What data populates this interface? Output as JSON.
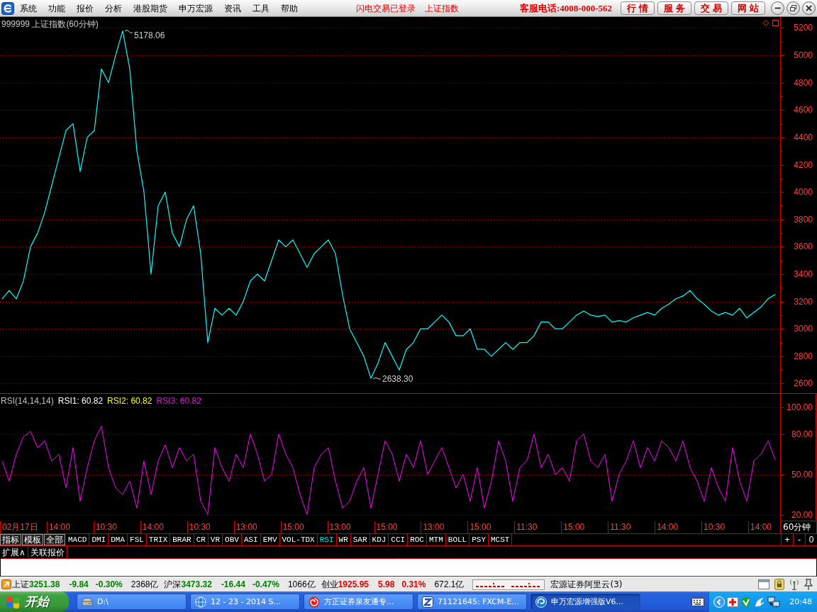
{
  "menu_bar": {
    "menus": [
      "系统",
      "功能",
      "报价",
      "分析",
      "港股期货",
      "申万宏源",
      "资讯",
      "工具",
      "帮助"
    ],
    "notices": [
      "闪电交易已登录",
      "上证指数"
    ],
    "hotline": "客服电话:4008-000-562",
    "buttons": [
      "行 情",
      "服 务",
      "交 易",
      "网 站"
    ]
  },
  "price_chart": {
    "chart_data": {
      "type": "line",
      "title": "999999 上证指数(60分钟)",
      "ylim": [
        2530,
        5280
      ],
      "yticks": [
        2600,
        2800,
        3000,
        3200,
        3400,
        3600,
        3800,
        4000,
        4200,
        4400,
        4600,
        4800,
        5000,
        5200
      ],
      "grid": true,
      "series": [
        {
          "color": "#00ffff",
          "values": [
            3220,
            3280,
            3220,
            3350,
            3600,
            3700,
            3850,
            4050,
            4250,
            4450,
            4500,
            4150,
            4400,
            4450,
            4900,
            4800,
            5000,
            5178,
            4900,
            4300,
            4000,
            3400,
            3900,
            4000,
            3700,
            3600,
            3800,
            3900,
            3550,
            2900,
            3150,
            3100,
            3150,
            3100,
            3200,
            3350,
            3400,
            3350,
            3500,
            3650,
            3600,
            3650,
            3550,
            3450,
            3550,
            3600,
            3650,
            3550,
            3250,
            3000,
            2900,
            2800,
            2638,
            2750,
            2900,
            2800,
            2700,
            2850,
            2900,
            3000,
            3000,
            3050,
            3100,
            3050,
            2950,
            2950,
            3000,
            2850,
            2850,
            2800,
            2850,
            2900,
            2850,
            2900,
            2900,
            2950,
            3050,
            3050,
            3000,
            3000,
            3050,
            3100,
            3130,
            3100,
            3090,
            3100,
            3050,
            3060,
            3050,
            3080,
            3100,
            3120,
            3100,
            3150,
            3180,
            3220,
            3240,
            3280,
            3220,
            3180,
            3130,
            3100,
            3120,
            3100,
            3150,
            3080,
            3120,
            3160,
            3220,
            3251
          ]
        }
      ],
      "annotations": [
        "5178.06",
        "2638.30"
      ]
    }
  },
  "rsi_chart": {
    "legend": [
      {
        "label": "RSI(14,14,14)",
        "color": "#c0c0c0"
      },
      {
        "label": "RSI1: 60.82",
        "color": "#ffffff"
      },
      {
        "label": "RSI2: 60.82",
        "color": "#ffff00"
      },
      {
        "label": "RSI3: 60.82",
        "color": "#ff00ff"
      }
    ],
    "chart_data": {
      "type": "line",
      "ylim": [
        15,
        110
      ],
      "yticks": [
        {
          "value": 20,
          "label": "20.00"
        },
        {
          "value": 50,
          "label": "50.00"
        },
        {
          "value": 80,
          "label": "80.00"
        },
        {
          "value": 100,
          "label": "100.00"
        }
      ],
      "grid": true,
      "series": [
        {
          "color": "#ff00ff",
          "values": [
            60,
            45,
            65,
            78,
            82,
            70,
            75,
            60,
            65,
            40,
            70,
            30,
            55,
            75,
            86,
            55,
            40,
            35,
            45,
            25,
            60,
            35,
            60,
            72,
            55,
            70,
            60,
            65,
            30,
            20,
            70,
            55,
            45,
            65,
            55,
            80,
            65,
            45,
            50,
            80,
            65,
            55,
            35,
            20,
            55,
            65,
            70,
            45,
            25,
            30,
            45,
            55,
            25,
            50,
            75,
            65,
            45,
            65,
            55,
            75,
            50,
            60,
            70,
            55,
            40,
            50,
            30,
            55,
            25,
            45,
            75,
            60,
            30,
            55,
            60,
            80,
            55,
            65,
            50,
            55,
            45,
            75,
            80,
            60,
            55,
            65,
            30,
            50,
            60,
            75,
            55,
            70,
            60,
            75,
            70,
            60,
            75,
            55,
            45,
            30,
            55,
            40,
            30,
            70,
            45,
            30,
            60,
            65,
            75,
            61
          ]
        }
      ]
    }
  },
  "time_axis": {
    "labels": [
      "02月17日",
      "14:00",
      "10:30",
      "14:00",
      "10:30",
      "13:00",
      "15:00",
      "13:00",
      "15:00",
      "13:00",
      "15:00",
      "11:30",
      "15:00",
      "11:30",
      "14:00",
      "10:30",
      "14:00"
    ],
    "period": "60分钟"
  },
  "indicator_bar": {
    "groups": [
      "指标",
      "模板",
      "全部"
    ],
    "indicators": [
      {
        "label": "MACD",
        "selected": false
      },
      {
        "label": "DMI",
        "selected": false
      },
      {
        "label": "DMA",
        "selected": false
      },
      {
        "label": "FSL",
        "selected": false
      },
      {
        "label": "TRIX",
        "selected": false
      },
      {
        "label": "BRAR",
        "selected": false
      },
      {
        "label": "CR",
        "selected": false
      },
      {
        "label": "VR",
        "selected": false
      },
      {
        "label": "OBV",
        "selected": false
      },
      {
        "label": "ASI",
        "selected": false
      },
      {
        "label": "EMV",
        "selected": false
      },
      {
        "label": "VOL-TDX",
        "selected": false
      },
      {
        "label": "RSI",
        "selected": true
      },
      {
        "label": "WR",
        "selected": false
      },
      {
        "label": "SAR",
        "selected": false
      },
      {
        "label": "KDJ",
        "selected": false
      },
      {
        "label": "CCI",
        "selected": false
      },
      {
        "label": "ROC",
        "selected": false
      },
      {
        "label": "MTM",
        "selected": false
      },
      {
        "label": "BOLL",
        "selected": false
      },
      {
        "label": "PSY",
        "selected": false
      },
      {
        "label": "MCST",
        "selected": false
      }
    ],
    "zoom_buttons": [
      "+",
      "-",
      "0"
    ]
  },
  "extra_row": {
    "tabs": [
      "扩展∧",
      "关联报价"
    ]
  },
  "status_bar": {
    "indices": [
      {
        "name": "上证",
        "value": "3251.38",
        "change": "-9.84",
        "percent": "-0.30%",
        "turnover": "2368亿",
        "color": "#008000"
      },
      {
        "name": "沪深",
        "value": "3473.32",
        "change": "-16.44",
        "percent": "-0.47%",
        "turnover": "1066亿",
        "color": "#008000"
      },
      {
        "name": "创业",
        "value": "1925.95",
        "change": "5.98",
        "percent": "0.31%",
        "turnover": "672.1亿",
        "color": "#e00000"
      }
    ],
    "server": "宏源证券阿里云(3)"
  },
  "taskbar": {
    "start": "开始",
    "tasks": [
      {
        "label": "D:\\",
        "kind": "drive",
        "selected": false
      },
      {
        "label": "12 - 23 - 2014 S...",
        "kind": "browser",
        "selected": false
      },
      {
        "label": "方正证券泉友通专...",
        "kind": "swirl",
        "selected": false
      },
      {
        "label": "71121645: FXCM-E...",
        "kind": "zigzag",
        "selected": false
      },
      {
        "label": "申万宏源增强版V6...",
        "kind": "app",
        "selected": true
      }
    ],
    "clock": "20:48"
  }
}
